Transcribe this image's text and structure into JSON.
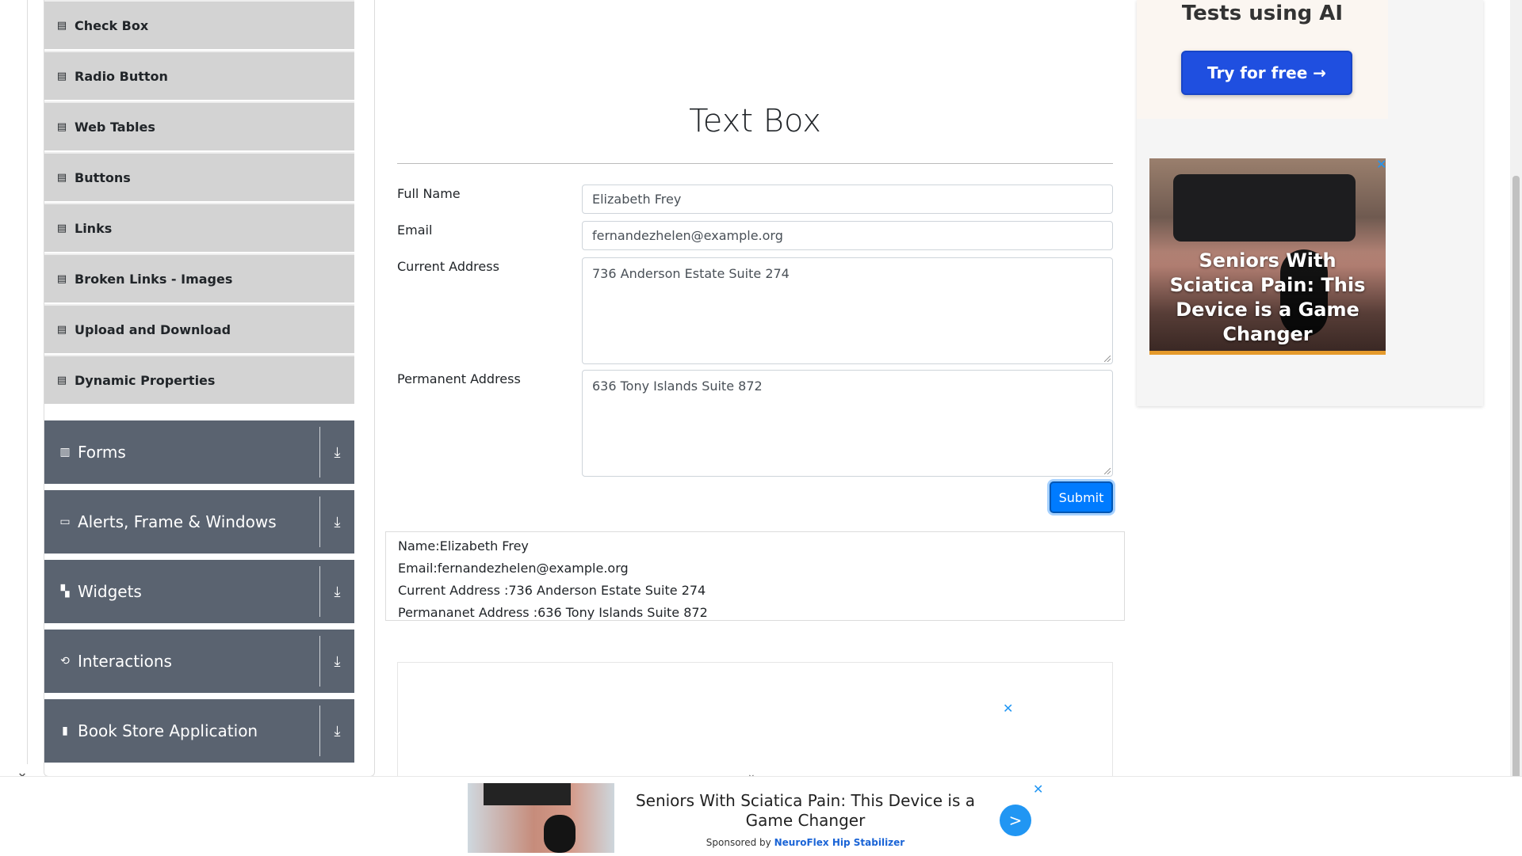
{
  "sidebar": {
    "element_items": [
      {
        "label": "Check Box",
        "icon": "list-icon"
      },
      {
        "label": "Radio Button",
        "icon": "list-icon"
      },
      {
        "label": "Web Tables",
        "icon": "list-icon"
      },
      {
        "label": "Buttons",
        "icon": "list-icon"
      },
      {
        "label": "Links",
        "icon": "list-icon"
      },
      {
        "label": "Broken Links - Images",
        "icon": "list-icon"
      },
      {
        "label": "Upload and Download",
        "icon": "list-icon"
      },
      {
        "label": "Dynamic Properties",
        "icon": "list-icon"
      }
    ],
    "groups": [
      {
        "label": "Forms",
        "icon": "form-icon"
      },
      {
        "label": "Alerts, Frame & Windows",
        "icon": "window-icon"
      },
      {
        "label": "Widgets",
        "icon": "widgets-icon"
      },
      {
        "label": "Interactions",
        "icon": "interactions-icon"
      },
      {
        "label": "Book Store Application",
        "icon": "books-icon"
      }
    ]
  },
  "main": {
    "title": "Text Box",
    "form": {
      "full_name_label": "Full Name",
      "full_name_value": "Elizabeth Frey",
      "email_label": "Email",
      "email_value": "fernandezhelen@example.org",
      "current_address_label": "Current Address",
      "current_address_value": "736 Anderson Estate Suite 274",
      "permanent_address_label": "Permanent Address",
      "permanent_address_value": "636 Tony Islands Suite 872",
      "submit_label": "Submit"
    },
    "output": {
      "name": "Name:Elizabeth Frey",
      "email": "Email:fernandezhelen@example.org",
      "current_address": "Current Address :736 Anderson Estate Suite 274",
      "permanent_address": "Permananet Address :636 Tony Islands Suite 872"
    }
  },
  "right_ad": {
    "heading": "Tests using AI",
    "cta": "Try for free →",
    "promo_text": "Seniors With Sciatica Pain: This Device is a Game Changer",
    "close": "✕"
  },
  "bottom_ad": {
    "headline": "Seniors With Sciatica Pain: This Device is a Game Changer",
    "sponsored_prefix": "Sponsored by",
    "brand": "NeuroFlex Hip Stabilizer",
    "go": ">",
    "close": "✕"
  },
  "inline_ad": {
    "close": "✕"
  },
  "colors": {
    "accent": "#007bff",
    "sidebar_group": "#5a6370",
    "sidebar_item": "#d3d3d3",
    "ad_cta": "#1f4fe0"
  }
}
